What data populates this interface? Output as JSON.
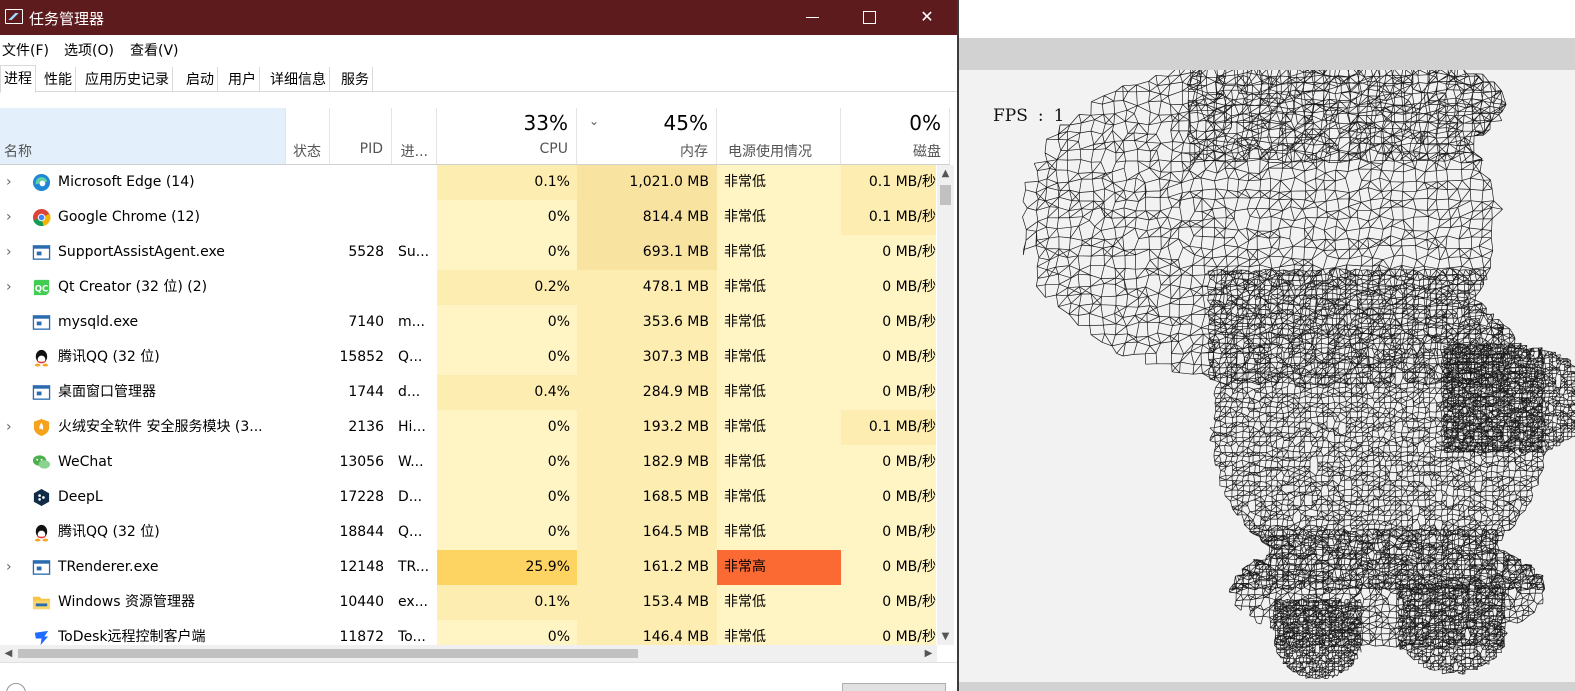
{
  "window": {
    "title": "任务管理器",
    "controls": {
      "minimize": "minimize-icon",
      "maximize": "maximize-icon",
      "close": "✕"
    }
  },
  "menu": [
    "文件(F)",
    "选项(O)",
    "查看(V)"
  ],
  "tabs": [
    "进程",
    "性能",
    "应用历史记录",
    "启动",
    "用户",
    "详细信息",
    "服务"
  ],
  "columns": {
    "name": "名称",
    "status": "状态",
    "pid": "PID",
    "proc": "进...",
    "cpu": {
      "label": "CPU",
      "percent": "33%"
    },
    "memory": {
      "label": "内存",
      "percent": "45%"
    },
    "power": "电源使用情况",
    "disk": {
      "label": "磁盘",
      "percent": "0%"
    }
  },
  "processes": [
    {
      "name": "Microsoft Edge (14)",
      "pid": "",
      "proc": "",
      "cpu": "0.1%",
      "mem": "1,021.0 MB",
      "power": "非常低",
      "disk": "0.1 MB/秒",
      "expandable": true,
      "icon": "edge-icon"
    },
    {
      "name": "Google Chrome (12)",
      "pid": "",
      "proc": "",
      "cpu": "0%",
      "mem": "814.4 MB",
      "power": "非常低",
      "disk": "0.1 MB/秒",
      "expandable": true,
      "icon": "chrome-icon"
    },
    {
      "name": "SupportAssistAgent.exe",
      "pid": "5528",
      "proc": "Su...",
      "cpu": "0%",
      "mem": "693.1 MB",
      "power": "非常低",
      "disk": "0 MB/秒",
      "expandable": true,
      "icon": "app-window-icon"
    },
    {
      "name": "Qt Creator (32 位) (2)",
      "pid": "",
      "proc": "",
      "cpu": "0.2%",
      "mem": "478.1 MB",
      "power": "非常低",
      "disk": "0 MB/秒",
      "expandable": true,
      "icon": "qt-icon"
    },
    {
      "name": "mysqld.exe",
      "pid": "7140",
      "proc": "m...",
      "cpu": "0%",
      "mem": "353.6 MB",
      "power": "非常低",
      "disk": "0 MB/秒",
      "expandable": false,
      "icon": "app-window-icon"
    },
    {
      "name": "腾讯QQ (32 位)",
      "pid": "15852",
      "proc": "Q...",
      "cpu": "0%",
      "mem": "307.3 MB",
      "power": "非常低",
      "disk": "0 MB/秒",
      "expandable": false,
      "icon": "qq-icon"
    },
    {
      "name": "桌面窗口管理器",
      "pid": "1744",
      "proc": "d...",
      "cpu": "0.4%",
      "mem": "284.9 MB",
      "power": "非常低",
      "disk": "0 MB/秒",
      "expandable": false,
      "icon": "app-window-icon"
    },
    {
      "name": "火绒安全软件 安全服务模块 (3...",
      "pid": "2136",
      "proc": "Hi...",
      "cpu": "0%",
      "mem": "193.2 MB",
      "power": "非常低",
      "disk": "0.1 MB/秒",
      "expandable": true,
      "icon": "huorong-icon"
    },
    {
      "name": "WeChat",
      "pid": "13056",
      "proc": "W...",
      "cpu": "0%",
      "mem": "182.9 MB",
      "power": "非常低",
      "disk": "0 MB/秒",
      "expandable": false,
      "icon": "wechat-icon"
    },
    {
      "name": "DeepL",
      "pid": "17228",
      "proc": "D...",
      "cpu": "0%",
      "mem": "168.5 MB",
      "power": "非常低",
      "disk": "0 MB/秒",
      "expandable": false,
      "icon": "deepl-icon"
    },
    {
      "name": "腾讯QQ (32 位)",
      "pid": "18844",
      "proc": "Q...",
      "cpu": "0%",
      "mem": "164.5 MB",
      "power": "非常低",
      "disk": "0 MB/秒",
      "expandable": false,
      "icon": "qq-icon"
    },
    {
      "name": "TRenderer.exe",
      "pid": "12148",
      "proc": "TR...",
      "cpu": "25.9%",
      "mem": "161.2 MB",
      "power": "非常高",
      "disk": "0 MB/秒",
      "expandable": true,
      "icon": "app-window-icon"
    },
    {
      "name": "Windows 资源管理器",
      "pid": "10440",
      "proc": "ex...",
      "cpu": "0.1%",
      "mem": "153.4 MB",
      "power": "非常低",
      "disk": "0 MB/秒",
      "expandable": false,
      "icon": "folder-icon"
    },
    {
      "name": "ToDesk远程控制客户端",
      "pid": "11872",
      "proc": "To...",
      "cpu": "0%",
      "mem": "146.4 MB",
      "power": "非常低",
      "disk": "0 MB/秒",
      "expandable": false,
      "icon": "todesk-icon"
    }
  ],
  "renderer": {
    "fps_label": "FPS",
    "fps_sep": ":",
    "fps_value": "1"
  },
  "colors": {
    "titlebar": "#5e1b1d",
    "heat_low": "#fff4c4",
    "heat_mid": "#fdedb0",
    "heat_hot": "#fdd462",
    "heat_critical": "#fc6a34"
  }
}
